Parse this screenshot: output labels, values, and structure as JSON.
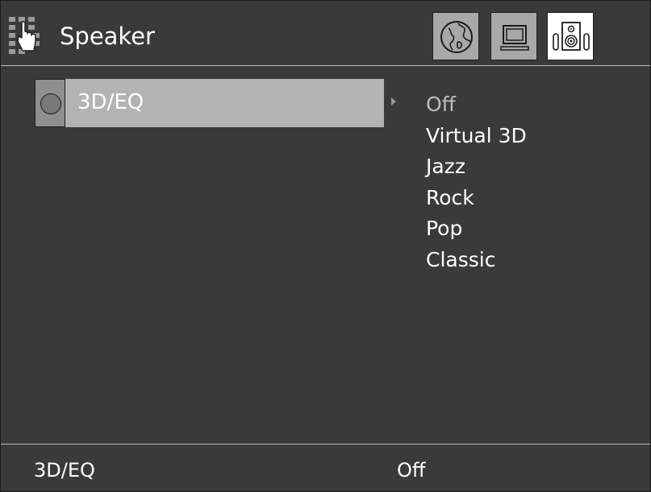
{
  "header": {
    "title": "Speaker",
    "menu_icon": "hand-cursor-grid-icon",
    "tabs": [
      {
        "name": "language",
        "icon": "globe-icon",
        "active": false
      },
      {
        "name": "video",
        "icon": "monitor-icon",
        "active": false
      },
      {
        "name": "speaker",
        "icon": "speaker-icon",
        "active": true
      }
    ]
  },
  "setting": {
    "label": "3D/EQ",
    "options": [
      "Off",
      "Virtual 3D",
      "Jazz",
      "Rock",
      "Pop",
      "Classic"
    ],
    "selected": "Off"
  },
  "footer": {
    "item_label": "3D/EQ",
    "item_value": "Off"
  },
  "colors": {
    "background": "#3a3a3a",
    "highlight": "#b3b3b3",
    "text": "#ffffff",
    "selected_option": "#bdbdbd"
  }
}
